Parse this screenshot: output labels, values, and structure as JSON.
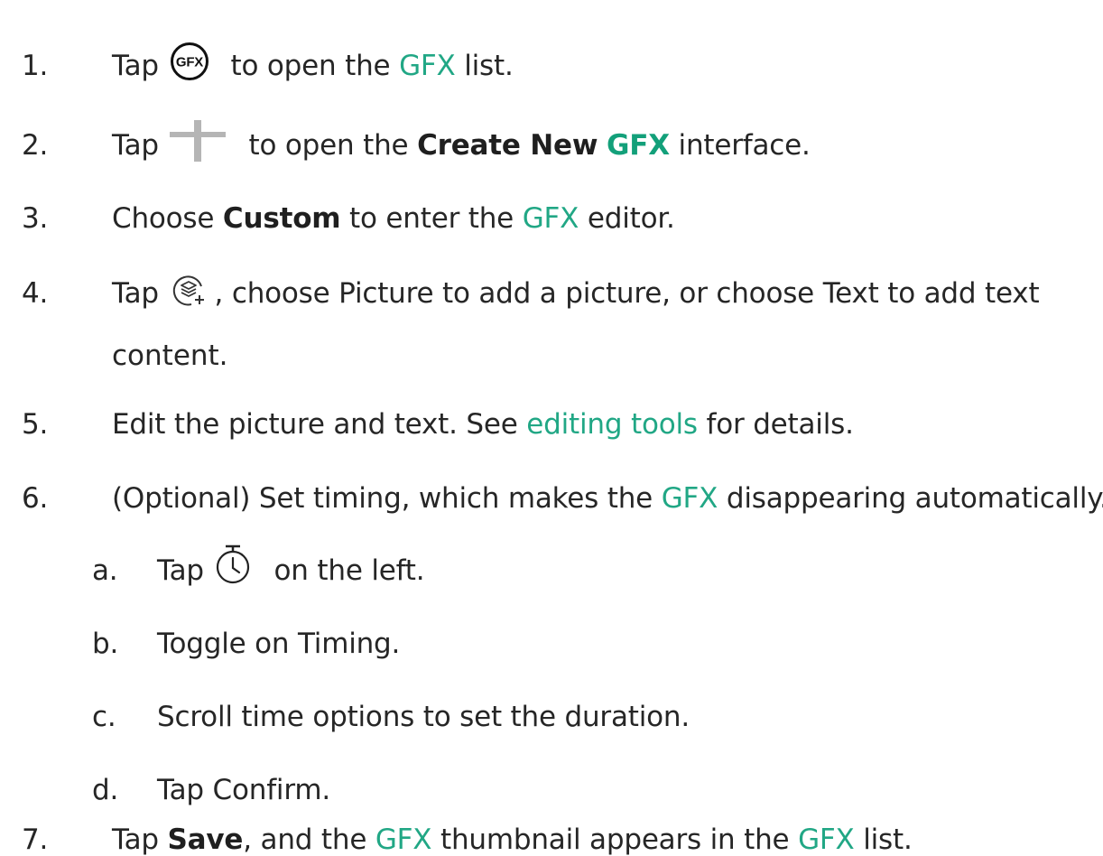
{
  "steps": [
    {
      "number": "1.",
      "parts": {
        "a": "Tap",
        "icon": "gfx-icon",
        "b": " to open the ",
        "link": "GFX",
        "c": " list."
      }
    },
    {
      "number": "2.",
      "parts": {
        "a": "Tap",
        "icon": "plus-icon",
        "b": " to open the ",
        "bold": "Create New",
        "sp": " ",
        "hl": "GFX",
        "c": " interface."
      }
    },
    {
      "number": "3.",
      "parts": {
        "a": "Choose ",
        "bold": "Custom",
        "b": " to enter the ",
        "link": "GFX",
        "c": " editor."
      }
    },
    {
      "number": "4.",
      "parts": {
        "a": "Tap",
        "icon": "layers-add-icon",
        "b": " , choose Picture to add a picture, or choose Text to add text",
        "cont": "content."
      }
    },
    {
      "number": "5.",
      "parts": {
        "a": "Edit the picture and text. See ",
        "link": "editing tools",
        "c": " for details."
      }
    },
    {
      "number": "6.",
      "parts": {
        "a": "(Optional) Set timing, which makes the ",
        "link": "GFX",
        "c": " disappearing automatically."
      },
      "substeps": [
        {
          "letter": "a.",
          "a": "Tap",
          "icon": "timer-icon",
          "c": " on the left."
        },
        {
          "letter": "b.",
          "a": "Toggle on Timing."
        },
        {
          "letter": "c.",
          "a": "Scroll time options to set the duration."
        },
        {
          "letter": "d.",
          "a": "Tap Confirm."
        }
      ]
    },
    {
      "number": "7.",
      "parts": {
        "a": "Tap ",
        "bold": "Save",
        "b": ", and the ",
        "link": "GFX",
        "c": " thumbnail appears in the ",
        "link2": "GFX",
        "d": " list."
      }
    }
  ],
  "colors": {
    "text": "#262626",
    "link": "#21a785",
    "highlight": "#13a07a",
    "icon_gray": "#b5b5b5"
  }
}
